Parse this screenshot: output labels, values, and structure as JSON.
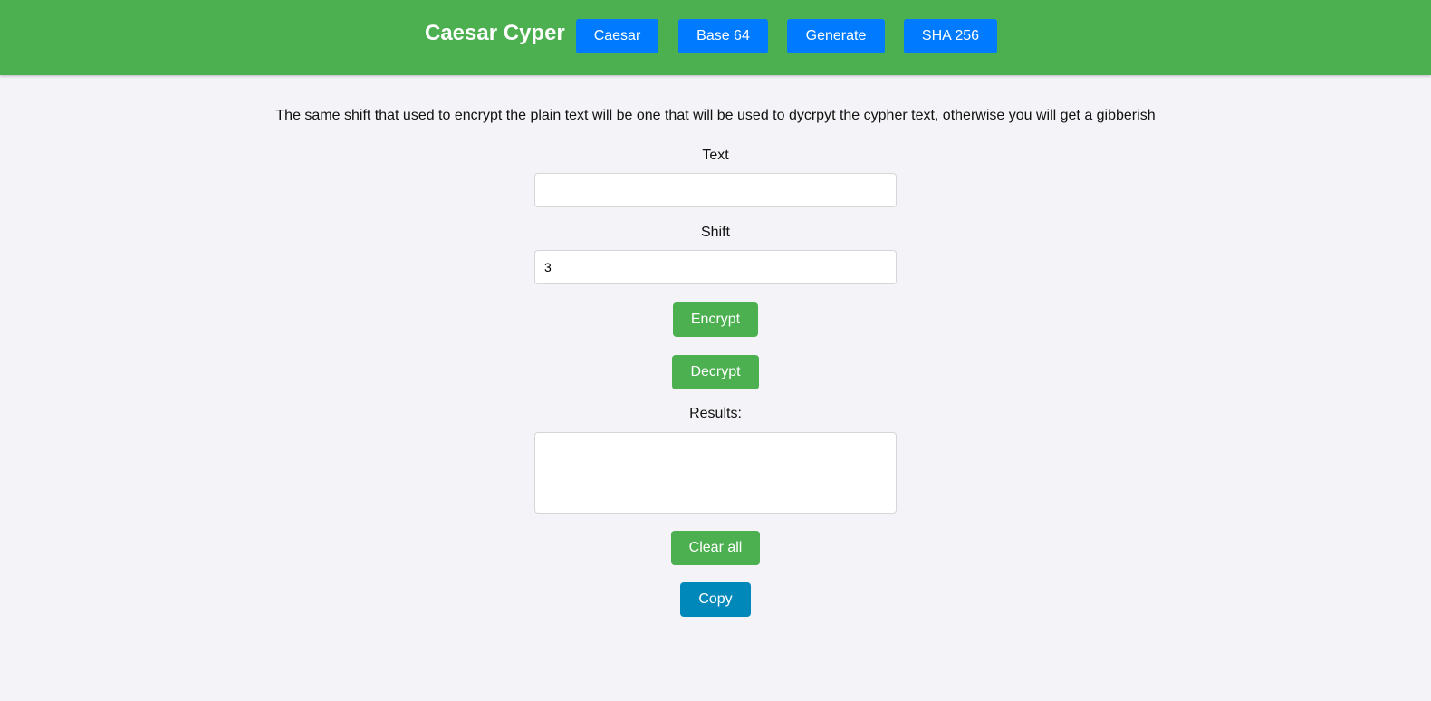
{
  "header": {
    "brand": "Caesar Cyper",
    "nav": [
      {
        "label": "Caesar"
      },
      {
        "label": "Base 64"
      },
      {
        "label": "Generate"
      },
      {
        "label": "SHA 256"
      }
    ]
  },
  "main": {
    "description": "The same shift that used to encrypt the plain text will be one that will be used to dycrpyt the cypher text, otherwise you will get a gibberish",
    "text_label": "Text",
    "text_value": "",
    "shift_label": "Shift",
    "shift_value": "3",
    "encrypt_label": "Encrypt",
    "decrypt_label": "Decrypt",
    "results_label": "Results:",
    "results_value": "",
    "clear_label": "Clear all",
    "copy_label": "Copy"
  },
  "colors": {
    "header_bg": "#4caf50",
    "nav_button": "#007bff",
    "action_button": "#4caf50",
    "copy_button": "#0088bb",
    "page_bg": "#f4f4f8"
  }
}
